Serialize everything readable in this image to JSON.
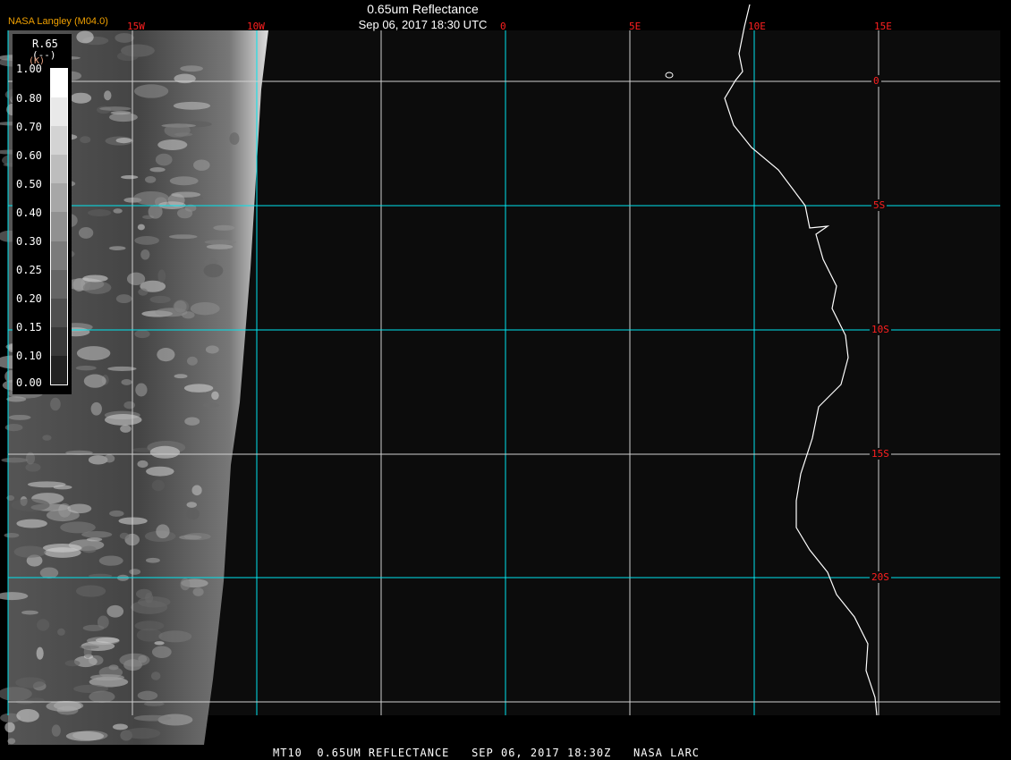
{
  "header": {
    "brand": "NASA Langley (M04.0)",
    "title": "0.65um Reflectance",
    "subtitle": "Sep 06, 2017 18:30 UTC"
  },
  "grid": {
    "longitudes": [
      "15W",
      "10W",
      "0",
      "5E",
      "10E",
      "15E"
    ],
    "latitudes": [
      "0",
      "5S",
      "10S",
      "15S",
      "20S"
    ]
  },
  "legend": {
    "title": "R.65",
    "units": "(--)",
    "unit_k": "(K)",
    "values": [
      "1.00",
      "0.80",
      "0.70",
      "0.60",
      "0.50",
      "0.40",
      "0.30",
      "0.25",
      "0.20",
      "0.15",
      "0.10",
      "0.00"
    ]
  },
  "footer": {
    "caption": "MT10  0.65UM REFLECTANCE   SEP 06, 2017 18:30Z   NASA LARC"
  },
  "colors": {
    "grid_major": "#00e5ee",
    "grid_minor": "#d0d0d0",
    "label": "#ff2020",
    "brand": "#f0a000"
  }
}
